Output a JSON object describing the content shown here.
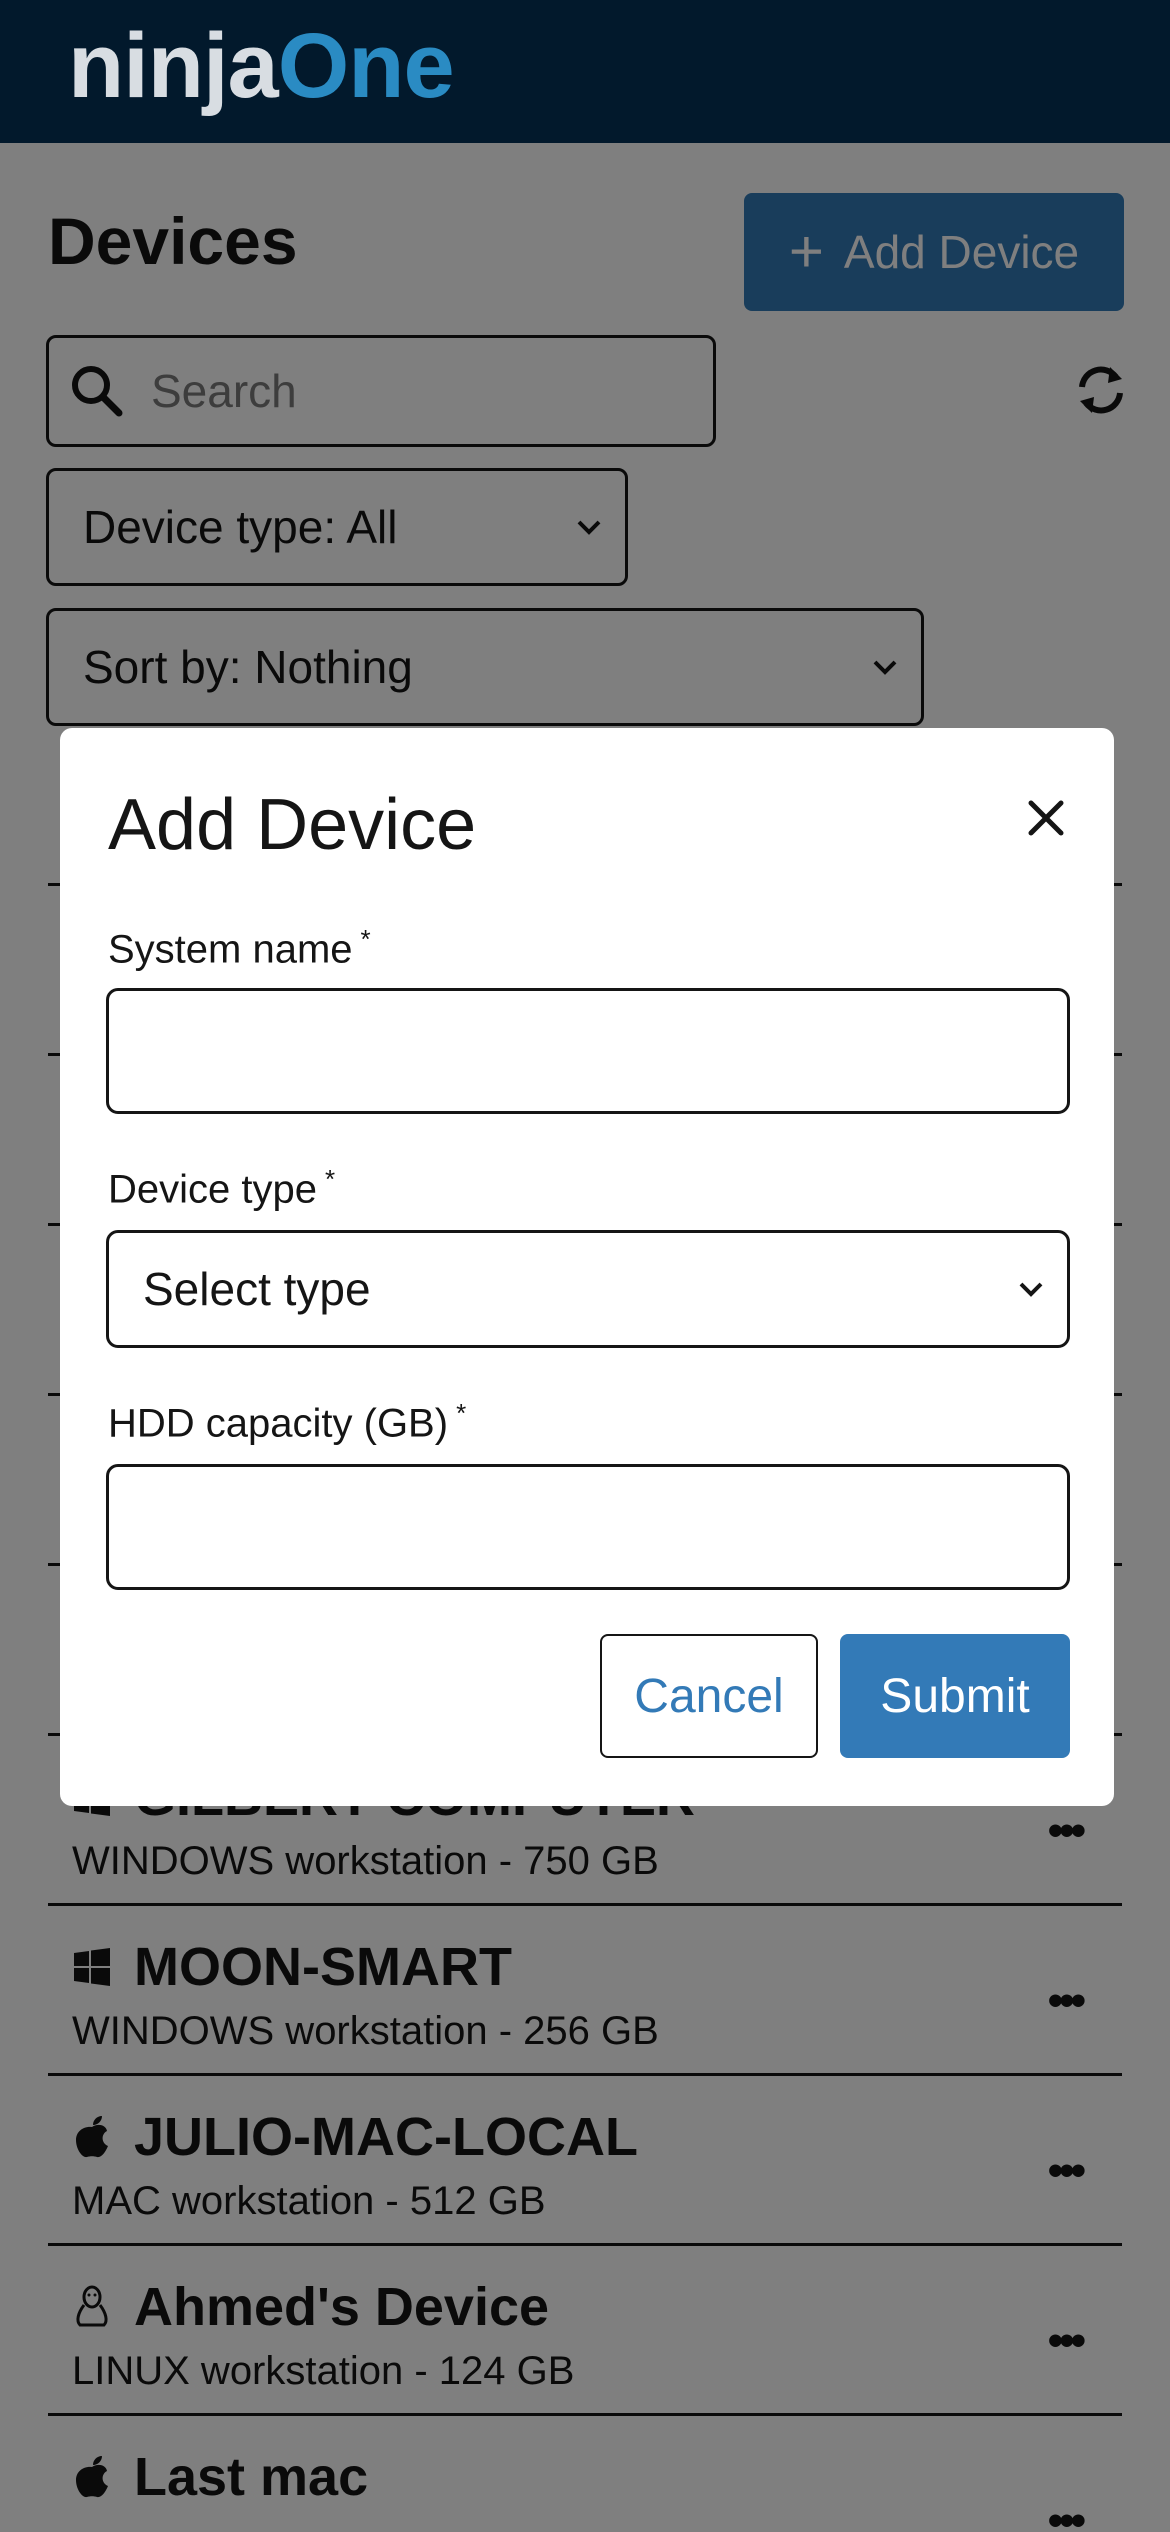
{
  "header": {
    "logo_ninja": "ninja",
    "logo_one": "One"
  },
  "page": {
    "title": "Devices",
    "add_button": "Add Device",
    "search_placeholder": "Search",
    "device_type_filter": "Device type: All",
    "sort_filter": "Sort by: Nothing"
  },
  "devices": [
    {
      "name": "GILBERT-COMPUTER",
      "subtitle": "WINDOWS workstation - 750 GB",
      "os_icon": "windows-icon"
    },
    {
      "name": "MOON-SMART",
      "subtitle": "WINDOWS workstation - 256 GB",
      "os_icon": "windows-icon"
    },
    {
      "name": "JULIO-MAC-LOCAL",
      "subtitle": "MAC workstation - 512 GB",
      "os_icon": "apple-icon"
    },
    {
      "name": "Ahmed's Device",
      "subtitle": "LINUX workstation - 124 GB",
      "os_icon": "linux-icon"
    },
    {
      "name": "Last mac",
      "subtitle": "",
      "os_icon": "apple-icon"
    }
  ],
  "more_glyph": "•••",
  "modal": {
    "title": "Add Device",
    "system_name_label": "System name",
    "device_type_label": "Device type",
    "device_type_value": "Select type",
    "hdd_label": "HDD capacity (GB)",
    "required_mark": "*",
    "cancel": "Cancel",
    "submit": "Submit"
  },
  "colors": {
    "header_bg": "#02192c",
    "accent": "#337ab7",
    "logo_one": "#2a8bc3"
  }
}
